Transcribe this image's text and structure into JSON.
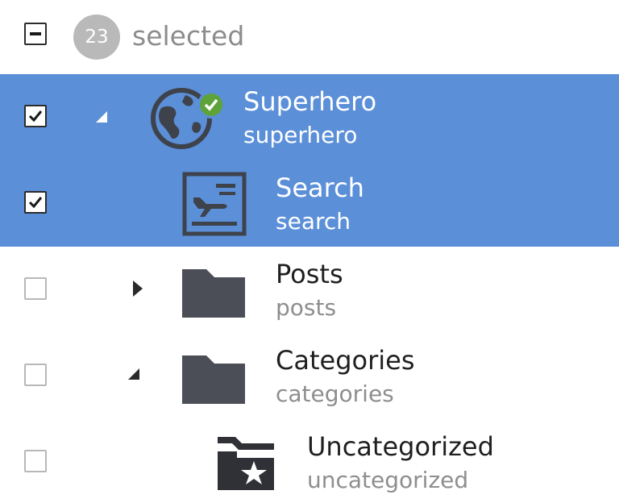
{
  "header": {
    "selected_count": "23",
    "selected_label": "selected"
  },
  "tree": {
    "items": [
      {
        "title": "Superhero",
        "subtitle": "superhero",
        "icon": "globe-icon",
        "checked": true,
        "expanded": true
      },
      {
        "title": "Search",
        "subtitle": "search",
        "icon": "search-page-icon",
        "checked": true
      },
      {
        "title": "Posts",
        "subtitle": "posts",
        "icon": "folder-icon",
        "checked": false,
        "expanded": false
      },
      {
        "title": "Categories",
        "subtitle": "categories",
        "icon": "folder-icon",
        "checked": false,
        "expanded": true
      },
      {
        "title": "Uncategorized",
        "subtitle": "uncategorized",
        "icon": "starred-folder-icon",
        "checked": false
      }
    ]
  },
  "colors": {
    "selection": "#5b8fd8",
    "status_ok": "#5da33a",
    "icon_dark": "#4b4e56"
  }
}
